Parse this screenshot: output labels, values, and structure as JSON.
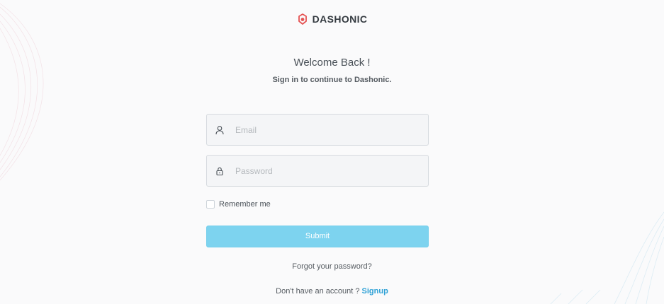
{
  "brand": {
    "name": "DASHONIC",
    "icon": "logo-icon",
    "accent_color": "#e55353"
  },
  "header": {
    "title": "Welcome Back !",
    "subtitle": "Sign in to continue to Dashonic."
  },
  "form": {
    "email": {
      "placeholder": "Email",
      "value": "",
      "icon": "user-icon"
    },
    "password": {
      "placeholder": "Password",
      "value": "",
      "icon": "lock-icon"
    },
    "remember_label": "Remember me",
    "remember_checked": false,
    "submit_label": "Submit",
    "submit_color": "#7dd3ef"
  },
  "footer": {
    "forgot_label": "Forgot your password?",
    "no_account_text": "Don't have an account ? ",
    "signup_label": "Signup",
    "signup_color": "#2ca0d6"
  }
}
